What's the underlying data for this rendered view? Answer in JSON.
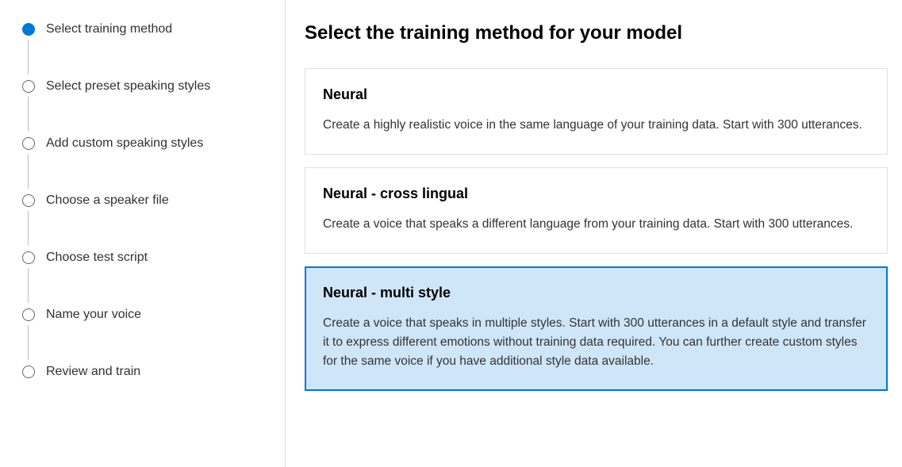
{
  "sidebar": {
    "steps": [
      {
        "label": "Select training method",
        "active": true
      },
      {
        "label": "Select preset speaking styles",
        "active": false
      },
      {
        "label": "Add custom speaking styles",
        "active": false
      },
      {
        "label": "Choose a speaker file",
        "active": false
      },
      {
        "label": "Choose test script",
        "active": false
      },
      {
        "label": "Name your voice",
        "active": false
      },
      {
        "label": "Review and train",
        "active": false
      }
    ]
  },
  "main": {
    "title": "Select the training method for your model",
    "options": [
      {
        "title": "Neural",
        "desc": "Create a highly realistic voice in the same language of your training data. Start with 300 utterances.",
        "selected": false
      },
      {
        "title": "Neural - cross lingual",
        "desc": "Create a voice that speaks a different language from your training data. Start with 300 utterances.",
        "selected": false
      },
      {
        "title": "Neural - multi style",
        "desc": "Create a voice that speaks in multiple styles. Start with 300 utterances in a default style and transfer it to express different emotions without training data required. You can further create custom styles for the same voice if you have additional style data available.",
        "selected": true
      }
    ]
  }
}
